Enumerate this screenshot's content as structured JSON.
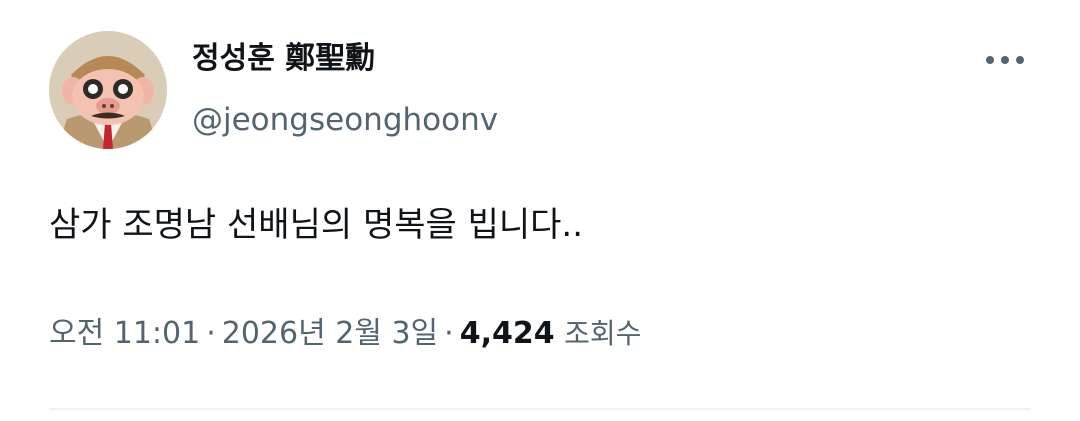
{
  "author": {
    "display_name": "정성훈 鄭聖勳",
    "handle": "@jeongseonghoonv",
    "avatar_icon": "cartoon-pig-pilot-avatar"
  },
  "more_icon": "more-horizontal-icon",
  "tweet": {
    "text": "삼가 조명남 선배님의 명복을 빕니다.."
  },
  "meta": {
    "time": "오전 11:01",
    "separator": "·",
    "date": "2026년 2월 3일",
    "views_count": "4,424",
    "views_label": "조회수"
  },
  "colors": {
    "text": "#0f1419",
    "secondary": "#536471",
    "divider": "#eff3f4"
  }
}
